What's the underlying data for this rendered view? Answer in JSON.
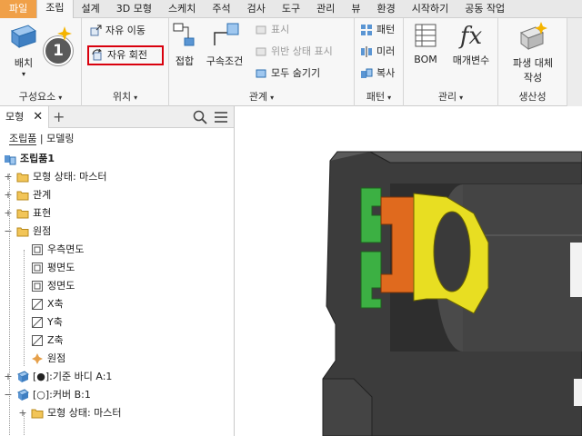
{
  "menu_tabs": [
    "파일",
    "조립",
    "설계",
    "3D 모형",
    "스케치",
    "주석",
    "검사",
    "도구",
    "관리",
    "뷰",
    "환경",
    "시작하기",
    "공동 작업"
  ],
  "ribbon": {
    "place_label": "배치",
    "free_move_label": "자유 이동",
    "free_rotate_label": "자유 회전",
    "constraint_label": "접합",
    "assemble_label": "구속조건",
    "show_label": "표시",
    "show_sick_label": "위반 상태 표시",
    "hide_all_label": "모두 숨기기",
    "pattern_label": "패턴",
    "mirror_label": "미러",
    "copy_label": "복사",
    "bom_label": "BOM",
    "params_label": "매개변수",
    "derived_sub_label_1": "파생 대체",
    "derived_sub_label_2": "작성",
    "panels": {
      "component": "구성요소",
      "position": "위치",
      "relationships": "관계",
      "pattern": "패턴",
      "manage": "관리",
      "productivity": "생산성"
    },
    "callout_number": "1",
    "fx_glyph": "fx"
  },
  "browser": {
    "tab_label": "모형",
    "close_glyph": "✕",
    "add_glyph": "+",
    "mode_assembly": "조립품",
    "mode_modeling": "모델링",
    "tree": [
      {
        "label": "조립품1",
        "level": 0,
        "exp": ""
      },
      {
        "label": "모형 상태: 마스터",
        "level": 0,
        "exp": "+"
      },
      {
        "label": "관계",
        "level": 0,
        "exp": "+"
      },
      {
        "label": "표현",
        "level": 0,
        "exp": "+"
      },
      {
        "label": "원점",
        "level": 0,
        "exp": "−"
      },
      {
        "label": "우측면도",
        "level": 1,
        "exp": ""
      },
      {
        "label": "평면도",
        "level": 1,
        "exp": ""
      },
      {
        "label": "정면도",
        "level": 1,
        "exp": ""
      },
      {
        "label": "X축",
        "level": 1,
        "exp": ""
      },
      {
        "label": "Y축",
        "level": 1,
        "exp": ""
      },
      {
        "label": "Z축",
        "level": 1,
        "exp": ""
      },
      {
        "label": "원점",
        "level": 1,
        "exp": ""
      },
      {
        "label": "[●]:기준 바디 A:1",
        "level": 0,
        "exp": "+"
      },
      {
        "label": "[○]:커버 B:1",
        "level": 0,
        "exp": "−"
      },
      {
        "label": "모형 상태: 마스터",
        "level": 1,
        "exp": "+"
      }
    ]
  },
  "colors": {
    "file_tab": "#f0a048",
    "highlight_red": "#d9000d",
    "part_green": "#2fa82f",
    "part_orange": "#e06a1e",
    "part_yellow": "#f2e82a",
    "part_dark": "#3a3a3a"
  }
}
